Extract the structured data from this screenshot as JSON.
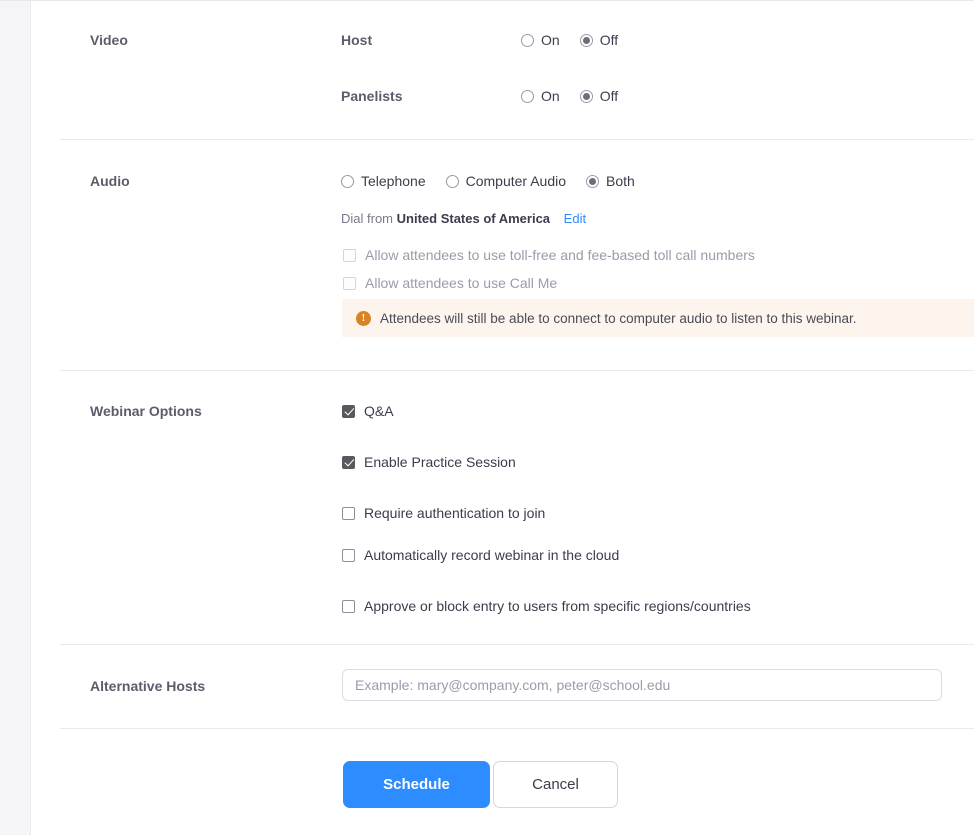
{
  "sections": {
    "video": {
      "label": "Video",
      "rows": [
        {
          "label": "Host",
          "options": [
            {
              "text": "On",
              "checked": false
            },
            {
              "text": "Off",
              "checked": true
            }
          ]
        },
        {
          "label": "Panelists",
          "options": [
            {
              "text": "On",
              "checked": false
            },
            {
              "text": "Off",
              "checked": true
            }
          ]
        }
      ]
    },
    "audio": {
      "label": "Audio",
      "options": [
        {
          "text": "Telephone",
          "checked": false
        },
        {
          "text": "Computer Audio",
          "checked": false
        },
        {
          "text": "Both",
          "checked": true
        }
      ],
      "dial_prefix": "Dial from",
      "dial_country": "United States of America",
      "dial_edit": "Edit",
      "checkboxes": [
        {
          "text": "Allow attendees to use toll-free and fee-based toll call numbers",
          "checked": false,
          "disabled": true
        },
        {
          "text": "Allow attendees to use Call Me",
          "checked": false,
          "disabled": true
        }
      ],
      "warning": {
        "icon": "warning-exclamation-icon",
        "text": "Attendees will still be able to connect to computer audio to listen to this webinar."
      }
    },
    "webinar_options": {
      "label": "Webinar Options",
      "checkboxes": [
        {
          "text": "Q&A",
          "checked": true
        },
        {
          "text": "Enable Practice Session",
          "checked": true
        },
        {
          "text": "Require authentication to join",
          "checked": false
        },
        {
          "text": "Automatically record webinar in the cloud",
          "checked": false
        },
        {
          "text": "Approve or block entry to users from specific regions/countries",
          "checked": false
        }
      ]
    },
    "alternative_hosts": {
      "label": "Alternative Hosts",
      "placeholder": "Example: mary@company.com, peter@school.edu",
      "value": ""
    }
  },
  "actions": {
    "schedule_label": "Schedule",
    "cancel_label": "Cancel"
  },
  "colors": {
    "accent_blue": "#2d8cff",
    "warning_bg": "#fdf5ed",
    "warning_icon": "#d98324",
    "label_gray": "#5c5c6b"
  }
}
